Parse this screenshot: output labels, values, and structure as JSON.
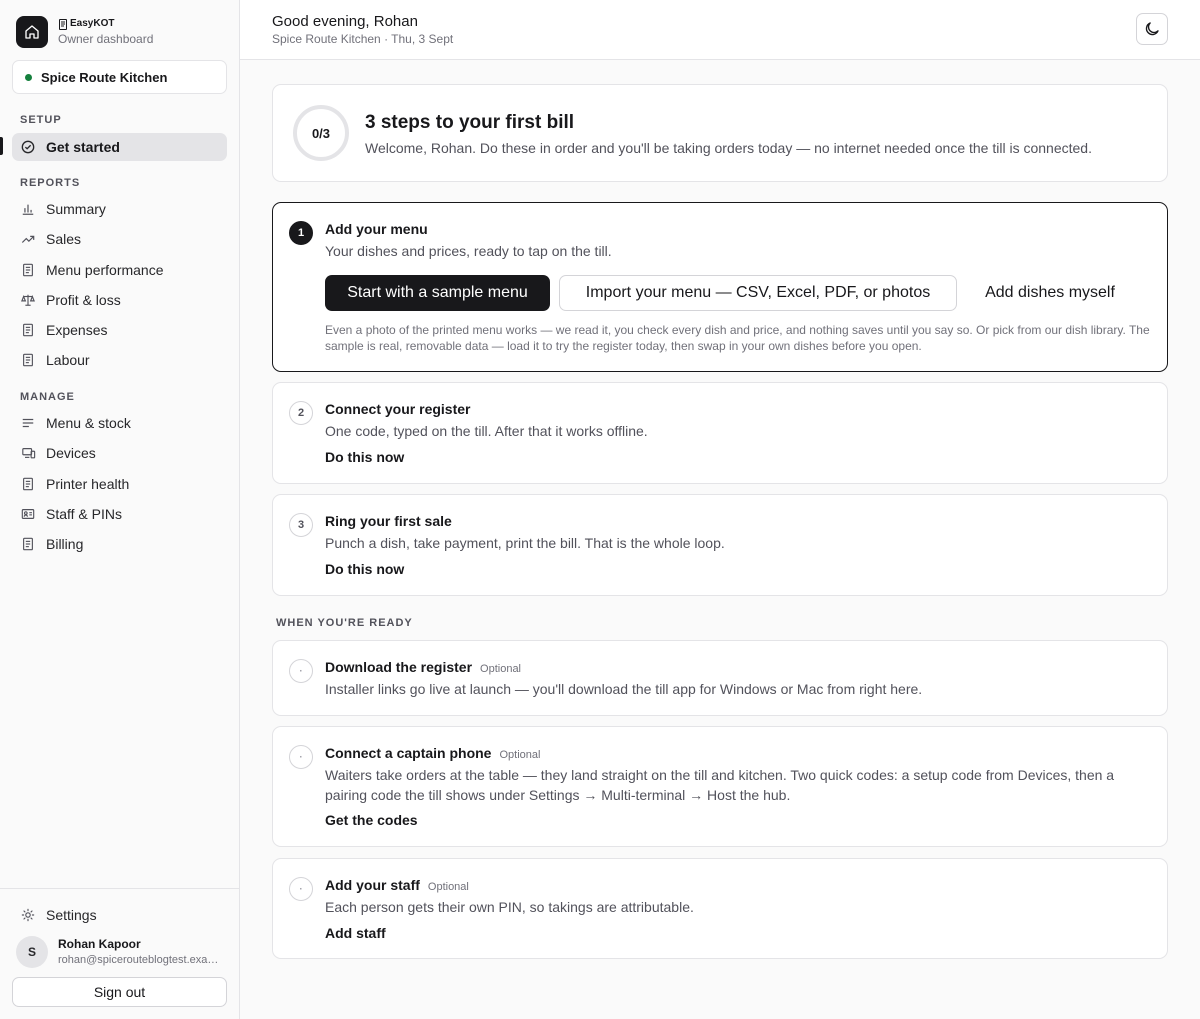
{
  "brand": {
    "name": "EasyKOT",
    "subtitle": "Owner dashboard"
  },
  "location": {
    "name": "Spice Route Kitchen",
    "status_color": "#15803d"
  },
  "sidebar": {
    "setup_label": "SETUP",
    "setup_items": [
      {
        "label": "Get started",
        "icon": "check-circle-icon",
        "active": true
      }
    ],
    "reports_label": "REPORTS",
    "reports_items": [
      {
        "label": "Summary",
        "icon": "bar-chart-icon"
      },
      {
        "label": "Sales",
        "icon": "trending-up-icon"
      },
      {
        "label": "Menu performance",
        "icon": "document-icon"
      },
      {
        "label": "Profit & loss",
        "icon": "scale-icon"
      },
      {
        "label": "Expenses",
        "icon": "document-icon"
      },
      {
        "label": "Labour",
        "icon": "document-icon"
      }
    ],
    "manage_label": "MANAGE",
    "manage_items": [
      {
        "label": "Menu & stock",
        "icon": "list-icon"
      },
      {
        "label": "Devices",
        "icon": "devices-icon"
      },
      {
        "label": "Printer health",
        "icon": "document-icon"
      },
      {
        "label": "Staff & PINs",
        "icon": "id-card-icon"
      },
      {
        "label": "Billing",
        "icon": "document-icon"
      }
    ],
    "settings_label": "Settings",
    "user": {
      "initial": "S",
      "name": "Rohan Kapoor",
      "email": "rohan@spicerouteblogtest.example"
    },
    "signout_label": "Sign out"
  },
  "header": {
    "greeting": "Good evening, Rohan",
    "subline": "Spice Route Kitchen · Thu, 3 Sept",
    "theme_icon": "moon-icon"
  },
  "intro": {
    "progress_text": "0/3",
    "progress_fraction": 0,
    "title": "3 steps to your first bill",
    "description": "Welcome, Rohan. Do these in order and you'll be taking orders today — no internet needed once the till is connected."
  },
  "steps": [
    {
      "number": "1",
      "title": "Add your menu",
      "description": "Your dishes and prices, ready to tap on the till.",
      "primary_label": "Start with a sample menu",
      "outline_label": "Import your menu — CSV, Excel, PDF, or photos",
      "ghost_label": "Add dishes myself",
      "fineprint": "Even a photo of the printed menu works — we read it, you check every dish and price, and nothing saves until you say so. Or pick from our dish library. The sample is real, removable data — load it to try the register today, then swap in your own dishes before you open."
    },
    {
      "number": "2",
      "title": "Connect your register",
      "description": "One code, typed on the till. After that it works offline.",
      "link": "Do this now"
    },
    {
      "number": "3",
      "title": "Ring your first sale",
      "description": "Punch a dish, take payment, print the bill. That is the whole loop.",
      "link": "Do this now"
    }
  ],
  "ready_label": "WHEN YOU'RE READY",
  "optional_tag": "Optional",
  "optional_steps": [
    {
      "marker": "·",
      "title": "Download the register",
      "description": "Installer links go live at launch — you'll download the till app for Windows or Mac from right here."
    },
    {
      "marker": "·",
      "title": "Connect a captain phone",
      "description": "Waiters take orders at the table — they land straight on the till and kitchen. Two quick codes: a setup code from Devices, then a pairing code the till shows under Settings → Multi-terminal → Host the hub.",
      "link": "Get the codes"
    },
    {
      "marker": "·",
      "title": "Add your staff",
      "description": "Each person gets their own PIN, so takings are attributable.",
      "link": "Add staff"
    }
  ]
}
